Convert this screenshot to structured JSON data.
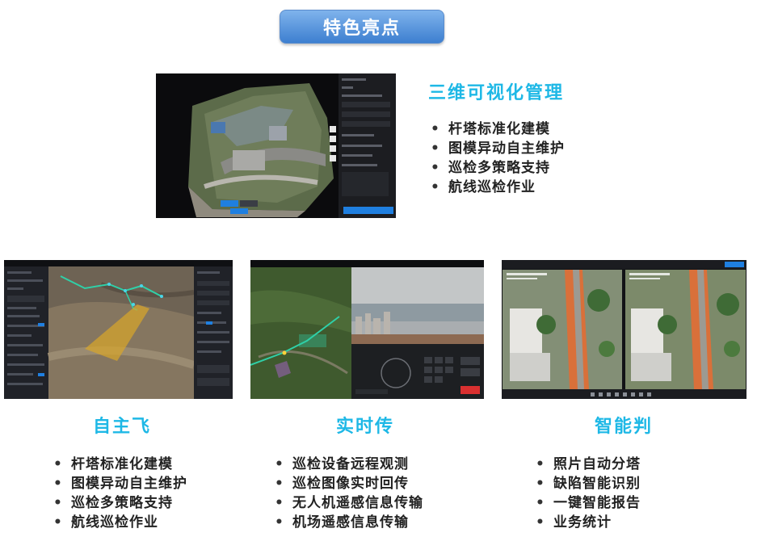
{
  "page_title": "特色亮点",
  "top_section": {
    "heading": "三维可视化管理",
    "bullets": [
      "杆塔标准化建模",
      "图模异动自主维护",
      "巡检多策略支持",
      "航线巡检作业"
    ]
  },
  "columns": [
    {
      "heading": "自主飞",
      "bullets": [
        "杆塔标准化建模",
        "图模异动自主维护",
        "巡检多策略支持",
        "航线巡检作业"
      ]
    },
    {
      "heading": "实时传",
      "bullets": [
        "巡检设备远程观测",
        "巡检图像实时回传",
        "无人机遥感信息传输",
        "机场遥感信息传输"
      ]
    },
    {
      "heading": "智能判",
      "bullets": [
        "照片自动分塔",
        "缺陷智能识别",
        "一键智能报告",
        "业务统计"
      ]
    }
  ],
  "bullet_marker": "•",
  "colors": {
    "heading_cyan": "#1eb8e6",
    "title_pill": "#4a8ad8",
    "bullet_text": "#222222",
    "app_blue_button": "#1f7fe0",
    "road_orange": "#d9703a"
  }
}
